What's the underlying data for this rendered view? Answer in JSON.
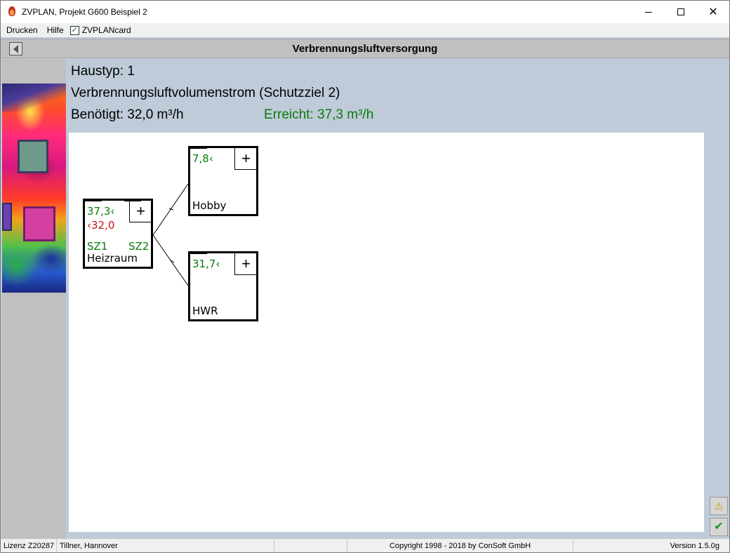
{
  "window": {
    "title": "ZVPLAN, Projekt G600 Beispiel 2"
  },
  "menu": {
    "drucken": "Drucken",
    "hilfe": "Hilfe",
    "zvplancard_label": "ZVPLANcard",
    "zvplancard_checked": true
  },
  "header": {
    "title": "Verbrennungsluftversorgung"
  },
  "info": {
    "haustyp": "Haustyp: 1",
    "volumenstrom": "Verbrennungsluftvolumenstrom (Schutzziel 2)",
    "benoetigt": "Benötigt: 32,0 m³/h",
    "erreicht": "Erreicht: 37,3 m³/h"
  },
  "rooms": {
    "heizraum": {
      "name": "Heizraum",
      "value_green": "37,3‹",
      "value_red": "‹32,0",
      "sz1": "SZ1",
      "sz2": "SZ2"
    },
    "hobby": {
      "name": "Hobby",
      "value_green": "7,8‹"
    },
    "hwr": {
      "name": "HWR",
      "value_green": "31,7‹"
    }
  },
  "plus_glyph": "+",
  "statusbar": {
    "lizenz": "Lizenz Z20287",
    "owner": "Tillner, Hannover",
    "copyright": "Copyright 1998 - 2018 by ConSoft GmbH",
    "version": "Version 1.5.0g"
  },
  "colors": {
    "green": "#0a7a0a",
    "red": "#cc1111",
    "background": "#bfcbd9"
  }
}
